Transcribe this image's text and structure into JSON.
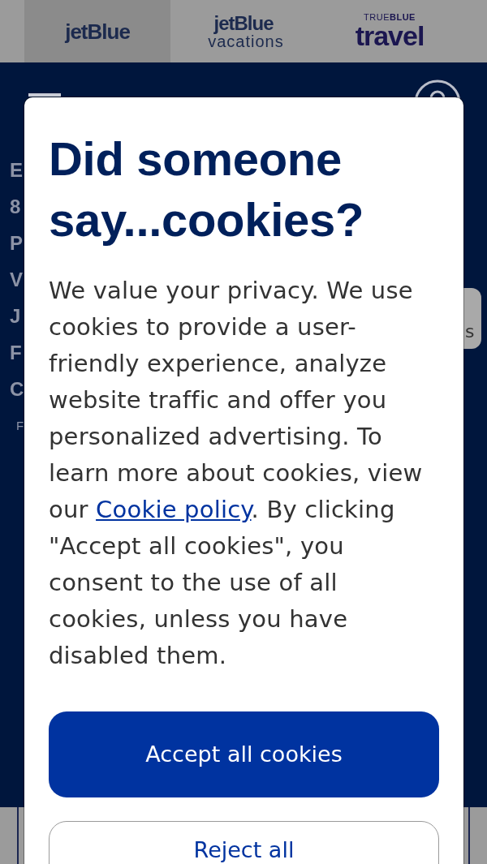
{
  "brand_tabs": [
    {
      "kind": "jetblue",
      "label": "jetBlue",
      "selected": true
    },
    {
      "kind": "vacations",
      "label": "jetBlue",
      "sublabel": "vacations",
      "selected": false
    },
    {
      "kind": "travel",
      "overline": "TRUE**BLUE**",
      "label": "travel",
      "selected": false
    }
  ],
  "background": {
    "line_starts": [
      {
        "kind": "large",
        "text": "E"
      },
      {
        "kind": "large",
        "text": "8"
      },
      {
        "kind": "large",
        "text": "P"
      },
      {
        "kind": "large",
        "text": "V"
      },
      {
        "kind": "large",
        "text": "J"
      },
      {
        "kind": "large",
        "text": "F"
      },
      {
        "kind": "large",
        "text": "C"
      },
      {
        "kind": "small",
        "text": "F"
      }
    ],
    "partial_button": {
      "label": "s"
    }
  },
  "cookie_dialog": {
    "title": "Did someone say...cookies?",
    "body": [
      {
        "kind": "text",
        "text": "We value your privacy. We use cookies to provide a user-friendly experience, analyze website traffic and offer you personalized advertising. To learn more about cookies, view our "
      },
      {
        "kind": "link",
        "text": "Cookie policy"
      },
      {
        "kind": "text",
        "text": ". By clicking \"Accept all cookies\", you consent to the use of all cookies, unless you have disabled them."
      }
    ],
    "buttons": [
      {
        "kind": "primary",
        "label": "Accept all cookies"
      },
      {
        "kind": "outline",
        "label": "Reject all"
      }
    ]
  }
}
